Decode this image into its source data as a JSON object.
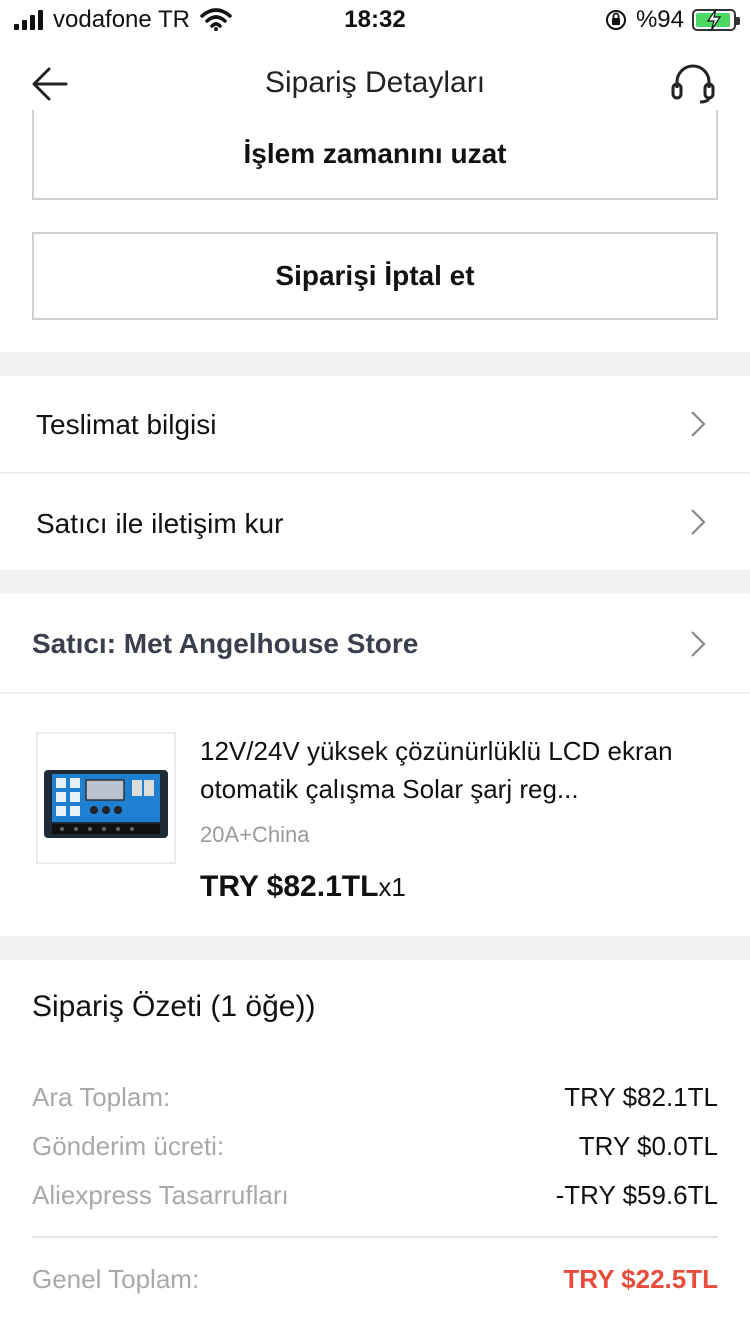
{
  "status_bar": {
    "carrier": "vodafone TR",
    "time": "18:32",
    "battery_pct": "%94"
  },
  "nav": {
    "title": "Sipariş Detayları",
    "back_icon": "arrow-left-icon",
    "support_icon": "headset-icon"
  },
  "actions": {
    "extend_label": "İşlem zamanını uzat",
    "cancel_label": "Siparişi İptal et"
  },
  "rows": {
    "delivery_info": "Teslimat bilgisi",
    "contact_seller": "Satıcı ile iletişim kur"
  },
  "seller": {
    "label": "Satıcı: Met Angelhouse Store"
  },
  "product": {
    "title": "12V/24V yüksek çözünürlüklü LCD ekran otomatik çalışma Solar şarj reg...",
    "variant": "20A+China",
    "price": "TRY $82.1TL",
    "qty": "x1",
    "image_icon": "solar-charge-controller-image"
  },
  "summary": {
    "title": "Sipariş Özeti  (1 öğe))",
    "subtotal_label": "Ara Toplam:",
    "subtotal_value": "TRY $82.1TL",
    "shipping_label": "Gönderim ücreti:",
    "shipping_value": "TRY $0.0TL",
    "savings_label": "Aliexpress Tasarrufları",
    "savings_value": "-TRY $59.6TL",
    "total_label": "Genel Toplam:",
    "total_value": "TRY $22.5TL"
  },
  "colors": {
    "accent_total": "#e74c3c",
    "battery_green": "#4cd964",
    "band_gray": "#f2f2f2"
  }
}
